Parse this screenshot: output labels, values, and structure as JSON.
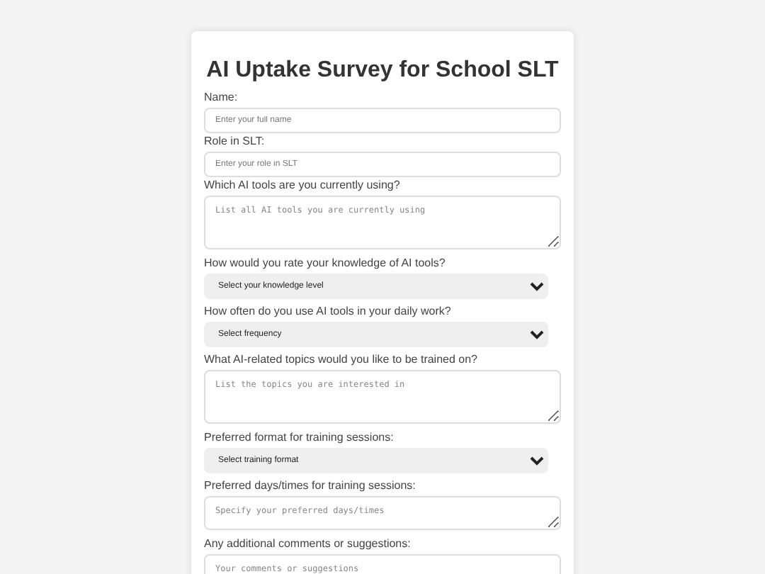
{
  "title": "AI Uptake Survey for School SLT",
  "fields": [
    {
      "kind": "input",
      "label": "Name:",
      "placeholder": "Enter your full name"
    },
    {
      "kind": "input",
      "label": "Role in SLT:",
      "placeholder": "Enter your role in SLT"
    },
    {
      "kind": "textarea",
      "label": "Which AI tools are you currently using?",
      "placeholder": "List all AI tools you are currently using"
    },
    {
      "kind": "select",
      "label": "How would you rate your knowledge of AI tools?",
      "value": "Select your knowledge level"
    },
    {
      "kind": "select",
      "label": "How often do you use AI tools in your daily work?",
      "value": "Select frequency"
    },
    {
      "kind": "textarea",
      "label": "What AI-related topics would you like to be trained on?",
      "placeholder": "List the topics you are interested in"
    },
    {
      "kind": "select",
      "label": "Preferred format for training sessions:",
      "value": "Select training format"
    },
    {
      "kind": "textarea-short",
      "label": "Preferred days/times for training sessions:",
      "placeholder": "Specify your preferred days/times"
    },
    {
      "kind": "textarea",
      "label": "Any additional comments or suggestions:",
      "placeholder": "Your comments or suggestions"
    }
  ]
}
